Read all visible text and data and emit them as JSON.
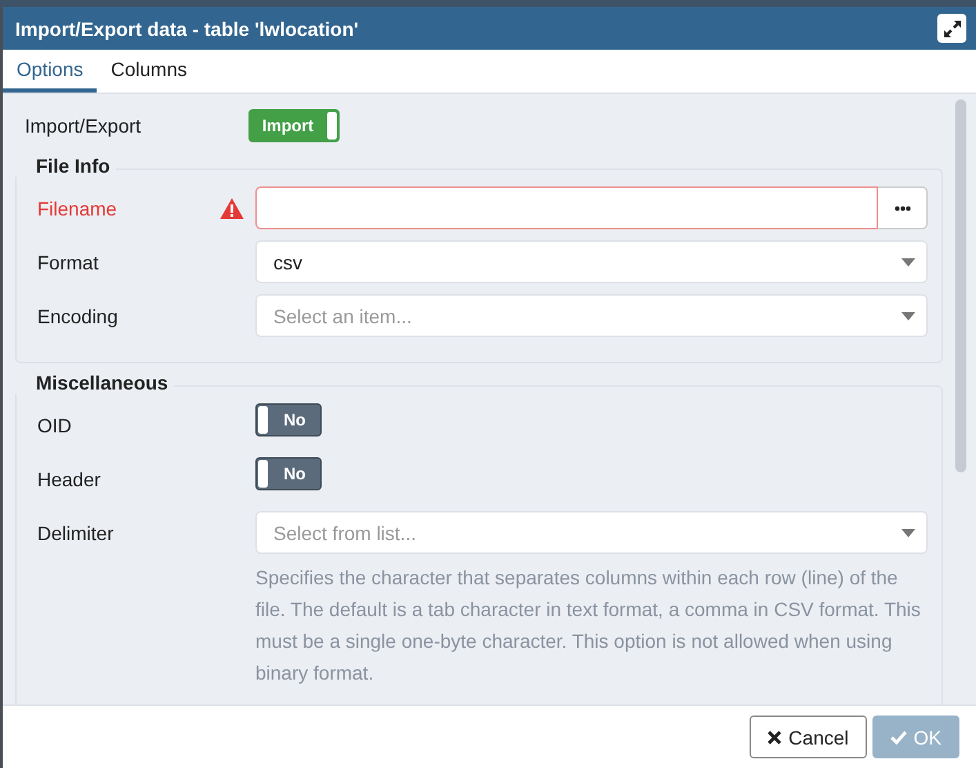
{
  "dialog": {
    "title": "Import/Export data - table 'lwlocation'"
  },
  "tabs": [
    {
      "label": "Options",
      "selected": true
    },
    {
      "label": "Columns",
      "selected": false
    }
  ],
  "import_export": {
    "label": "Import/Export",
    "toggle": {
      "label": "Import",
      "on": true
    }
  },
  "sections": [
    {
      "legend": "File Info",
      "fields": [
        {
          "kind": "file",
          "label": "Filename",
          "error": true
        },
        {
          "kind": "select",
          "label": "Format",
          "value": "csv",
          "error": false
        },
        {
          "kind": "select",
          "label": "Encoding",
          "placeholder": "Select an item...",
          "error": false
        }
      ]
    },
    {
      "legend": "Miscellaneous",
      "fields": [
        {
          "kind": "toggle",
          "label": "OID",
          "toggle": {
            "label": "No",
            "on": false
          }
        },
        {
          "kind": "toggle",
          "label": "Header",
          "toggle": {
            "label": "No",
            "on": false
          }
        },
        {
          "kind": "select",
          "label": "Delimiter",
          "placeholder": "Select from list...",
          "error": false,
          "help": "Specifies the character that separates columns within each row (line) of the file. The default is a tab character in text format, a comma in CSV format. This must be a single one-byte character. This option is not allowed when using binary format."
        }
      ]
    }
  ],
  "buttons": [
    {
      "kind": "cancel",
      "label": "Cancel",
      "disabled": false
    },
    {
      "kind": "ok",
      "label": "OK",
      "disabled": true
    }
  ]
}
